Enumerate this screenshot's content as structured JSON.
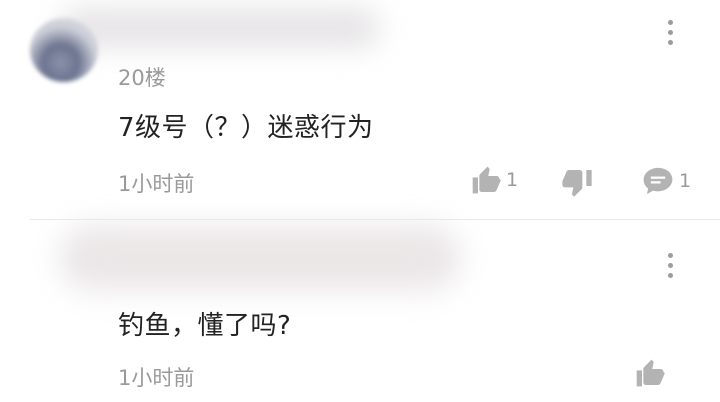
{
  "comments": [
    {
      "floor": "20楼",
      "text": "7级号（？）迷惑行为",
      "time": "1小时前",
      "likes": "1",
      "replies": "1"
    },
    {
      "text": "钓鱼，懂了吗?",
      "time": "1小时前"
    }
  ],
  "icons": {
    "more": "more-vertical-icon",
    "like": "thumbs-up-icon",
    "dislike": "thumbs-down-icon",
    "reply": "comment-bubble-icon"
  },
  "colors": {
    "icon_gray": "#b3b3b3",
    "text_main": "#222222",
    "text_meta": "#9a9a9a"
  }
}
